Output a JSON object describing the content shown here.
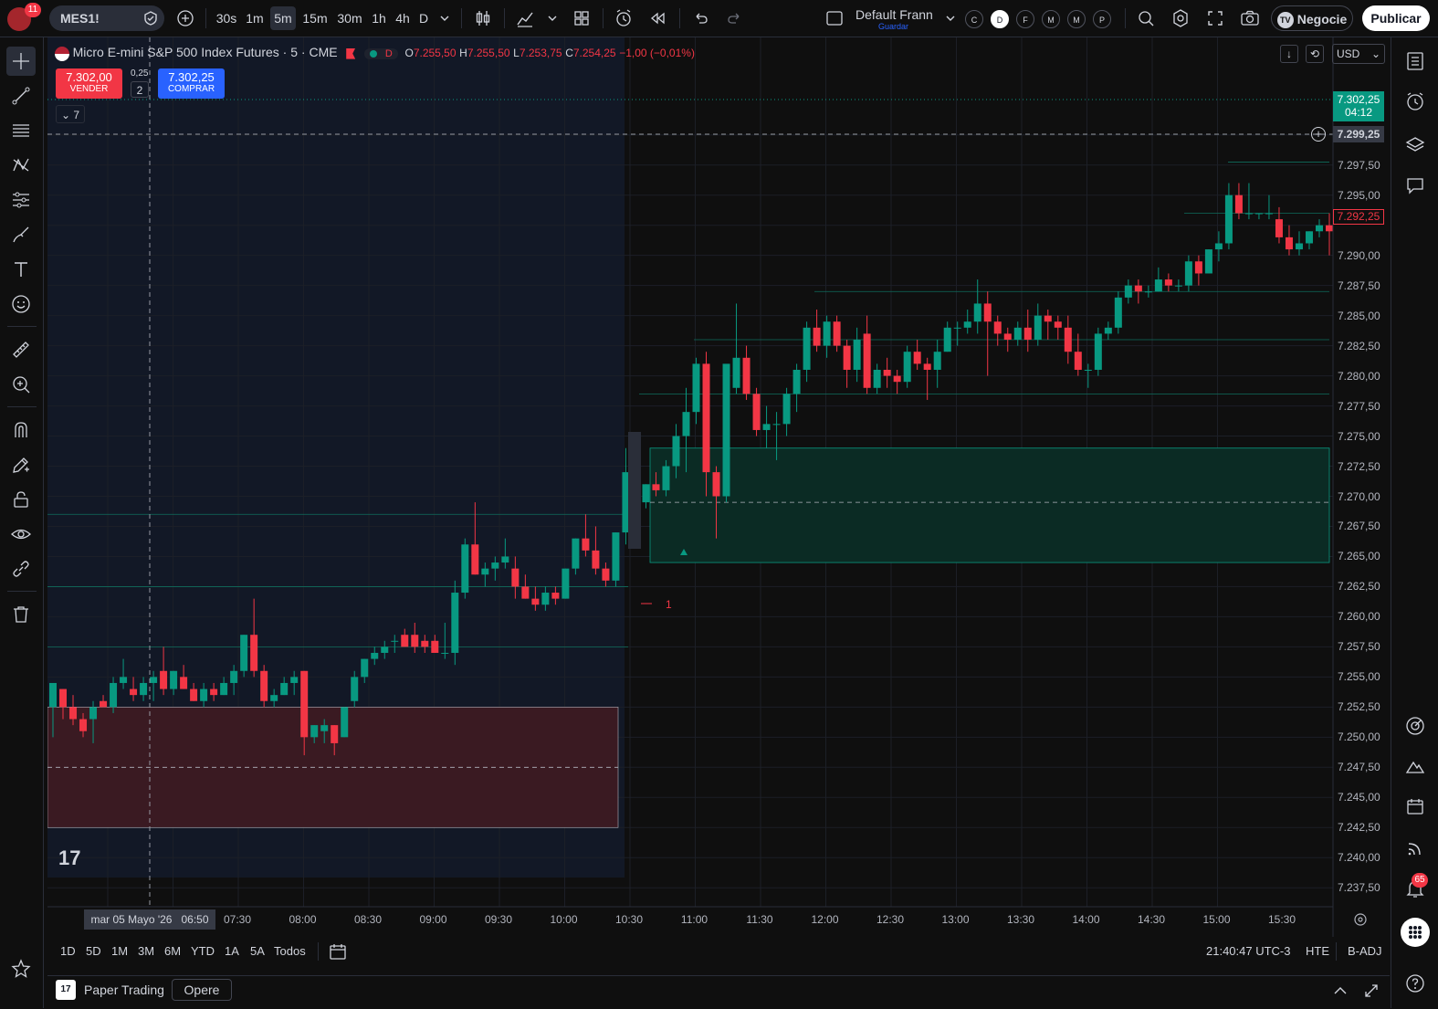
{
  "topbar": {
    "notif_count": "11",
    "symbol": "MES1!",
    "intervals": [
      "30s",
      "1m",
      "5m",
      "15m",
      "30m",
      "1h",
      "4h",
      "D"
    ],
    "active_interval": "5m",
    "layout_name": "Default Frann",
    "layout_sub": "Guardar",
    "quick_circles": [
      "C",
      "D",
      "F",
      "M",
      "M",
      "P"
    ],
    "trade_label": "Negocie",
    "publish_label": "Publicar"
  },
  "legend": {
    "title": "Micro E-mini S&P 500 Index Futures · 5 · CME",
    "d_badge": "D",
    "o_label": "O",
    "o_val": "7.255,50",
    "h_label": "H",
    "h_val": "7.255,50",
    "l_label": "L",
    "l_val": "7.253,75",
    "c_label": "C",
    "c_val": "7.254,25",
    "change": "−1,00 (−0,01%)",
    "currency": "USD",
    "sell_price": "7.302,00",
    "sell_label": "VENDER",
    "spread": "0,25",
    "qty": "2",
    "buy_price": "7.302,25",
    "buy_label": "COMPRAR",
    "indicator_count": "7"
  },
  "price_axis": {
    "labels": [
      "7.297,50",
      "7.295,00",
      "7.290,00",
      "7.287,50",
      "7.285,00",
      "7.282,50",
      "7.280,00",
      "7.277,50",
      "7.275,00",
      "7.272,50",
      "7.270,00",
      "7.267,50",
      "7.265,00",
      "7.262,50",
      "7.260,00",
      "7.257,50",
      "7.255,00",
      "7.252,50",
      "7.250,00",
      "7.247,50",
      "7.245,00",
      "7.242,50",
      "7.240,00",
      "7.237,50"
    ],
    "last_price": "7.302,25",
    "countdown": "04:12",
    "crosshair_price": "7.299,25",
    "marked_price": "7.292,25"
  },
  "time_axis": {
    "crosshair_date": "mar 05 Mayo '26",
    "crosshair_time": "06:50",
    "labels": [
      "07:30",
      "08:00",
      "08:30",
      "09:00",
      "09:30",
      "10:00",
      "10:30",
      "11:00",
      "11:30",
      "12:00",
      "12:30",
      "13:00",
      "13:30",
      "14:00",
      "14:30",
      "15:00",
      "15:30"
    ]
  },
  "chart": {
    "position_marker": "1",
    "up_color": "#089981",
    "down_color": "#f23645"
  },
  "chart_data": {
    "type": "candlestick",
    "title": "Micro E-mini S&P 500 Index Futures · 5 · CME",
    "ylim": [
      7236.0,
      7304.0
    ],
    "candles": [
      [
        7252.5,
        7254.5,
        7250.0,
        7254.5
      ],
      [
        7254.0,
        7254.0,
        7251.5,
        7252.5
      ],
      [
        7252.5,
        7253.5,
        7251.0,
        7251.5
      ],
      [
        7251.5,
        7252.0,
        7250.0,
        7250.5
      ],
      [
        7251.5,
        7253.0,
        7249.5,
        7252.5
      ],
      [
        7253.0,
        7253.5,
        7252.5,
        7252.5
      ],
      [
        7252.5,
        7255.0,
        7252.0,
        7254.5
      ],
      [
        7254.5,
        7256.5,
        7254.0,
        7255.0
      ],
      [
        7254.0,
        7255.0,
        7253.0,
        7253.5
      ],
      [
        7253.5,
        7255.0,
        7253.0,
        7254.5
      ],
      [
        7254.5,
        7255.5,
        7253.0,
        7255.0
      ],
      [
        7255.5,
        7257.5,
        7253.5,
        7254.0
      ],
      [
        7254.0,
        7255.5,
        7253.5,
        7255.5
      ],
      [
        7255.0,
        7256.0,
        7254.0,
        7254.0
      ],
      [
        7254.0,
        7254.5,
        7253.0,
        7253.0
      ],
      [
        7253.0,
        7254.5,
        7252.5,
        7254.0
      ],
      [
        7254.0,
        7254.5,
        7253.0,
        7253.5
      ],
      [
        7253.5,
        7255.0,
        7253.5,
        7254.5
      ],
      [
        7254.5,
        7256.0,
        7253.5,
        7255.5
      ],
      [
        7255.5,
        7258.5,
        7255.0,
        7258.5
      ],
      [
        7258.5,
        7261.5,
        7255.0,
        7255.5
      ],
      [
        7255.5,
        7256.0,
        7252.5,
        7253.0
      ],
      [
        7253.0,
        7254.0,
        7252.5,
        7253.5
      ],
      [
        7253.5,
        7255.0,
        7253.5,
        7254.5
      ],
      [
        7254.5,
        7255.5,
        7253.5,
        7255.0
      ],
      [
        7255.5,
        7255.5,
        7248.5,
        7250.0
      ],
      [
        7250.0,
        7251.0,
        7249.5,
        7251.0
      ],
      [
        7250.5,
        7251.5,
        7249.5,
        7251.0
      ],
      [
        7251.0,
        7251.0,
        7248.5,
        7249.5
      ],
      [
        7250.0,
        7252.5,
        7250.0,
        7252.5
      ],
      [
        7253.0,
        7255.5,
        7252.5,
        7255.0
      ],
      [
        7255.0,
        7256.5,
        7254.5,
        7256.5
      ],
      [
        7256.5,
        7257.5,
        7256.0,
        7257.0
      ],
      [
        7257.0,
        7258.0,
        7256.5,
        7257.5
      ],
      [
        7258.0,
        7258.5,
        7257.0,
        7258.0
      ],
      [
        7258.5,
        7259.0,
        7257.5,
        7257.5
      ],
      [
        7258.5,
        7259.5,
        7257.0,
        7257.5
      ],
      [
        7258.0,
        7258.5,
        7257.0,
        7257.5
      ],
      [
        7258.0,
        7258.5,
        7257.0,
        7257.0
      ],
      [
        7257.0,
        7259.5,
        7256.5,
        7257.0
      ],
      [
        7257.0,
        7263.0,
        7256.0,
        7262.0
      ],
      [
        7262.0,
        7266.5,
        7261.5,
        7266.0
      ],
      [
        7266.0,
        7269.5,
        7263.5,
        7263.5
      ],
      [
        7263.5,
        7264.5,
        7262.5,
        7264.0
      ],
      [
        7264.0,
        7265.0,
        7263.0,
        7264.5
      ],
      [
        7264.5,
        7266.5,
        7264.0,
        7265.0
      ],
      [
        7264.0,
        7265.0,
        7261.5,
        7262.5
      ],
      [
        7262.5,
        7263.5,
        7261.5,
        7261.5
      ],
      [
        7261.5,
        7262.5,
        7260.5,
        7261.0
      ],
      [
        7261.0,
        7262.5,
        7260.5,
        7262.0
      ],
      [
        7262.0,
        7262.5,
        7261.0,
        7261.5
      ],
      [
        7261.5,
        7264.0,
        7261.5,
        7264.0
      ],
      [
        7264.0,
        7266.5,
        7263.5,
        7266.5
      ],
      [
        7266.5,
        7268.5,
        7265.0,
        7265.5
      ],
      [
        7265.5,
        7267.5,
        7263.5,
        7264.0
      ],
      [
        7264.0,
        7264.5,
        7262.5,
        7263.0
      ],
      [
        7263.0,
        7267.0,
        7262.5,
        7267.0
      ],
      [
        7267.0,
        7274.0,
        7266.0,
        7272.0
      ],
      [
        7272.0,
        7273.0,
        7269.0,
        7269.5
      ],
      [
        7269.5,
        7271.0,
        7269.0,
        7271.0
      ],
      [
        7271.0,
        7272.0,
        7270.0,
        7270.5
      ],
      [
        7270.5,
        7273.0,
        7270.0,
        7272.5
      ],
      [
        7272.5,
        7276.0,
        7271.5,
        7275.0
      ],
      [
        7275.0,
        7279.0,
        7272.0,
        7277.0
      ],
      [
        7277.0,
        7281.5,
        7276.0,
        7281.0
      ],
      [
        7281.0,
        7282.0,
        7270.0,
        7272.0
      ],
      [
        7272.0,
        7272.5,
        7266.5,
        7270.0
      ],
      [
        7270.0,
        7279.5,
        7269.5,
        7281.0
      ],
      [
        7279.0,
        7286.0,
        7278.5,
        7281.5
      ],
      [
        7281.5,
        7282.5,
        7278.0,
        7278.5
      ],
      [
        7278.5,
        7279.0,
        7275.0,
        7275.5
      ],
      [
        7275.5,
        7277.5,
        7274.0,
        7276.0
      ],
      [
        7276.0,
        7277.0,
        7273.0,
        7276.0
      ],
      [
        7276.0,
        7279.0,
        7275.0,
        7278.5
      ],
      [
        7278.5,
        7281.0,
        7277.0,
        7280.5
      ],
      [
        7280.5,
        7284.5,
        7279.5,
        7284.0
      ],
      [
        7284.0,
        7285.5,
        7282.0,
        7282.5
      ],
      [
        7282.5,
        7285.0,
        7281.5,
        7284.5
      ],
      [
        7284.5,
        7285.0,
        7282.0,
        7282.5
      ],
      [
        7282.5,
        7283.0,
        7279.0,
        7280.5
      ],
      [
        7280.5,
        7284.0,
        7279.5,
        7283.0
      ],
      [
        7283.5,
        7285.0,
        7278.5,
        7279.0
      ],
      [
        7279.0,
        7281.0,
        7278.5,
        7280.5
      ],
      [
        7280.5,
        7281.5,
        7279.0,
        7280.0
      ],
      [
        7280.0,
        7280.5,
        7278.5,
        7279.5
      ],
      [
        7279.5,
        7282.5,
        7279.0,
        7282.0
      ],
      [
        7282.0,
        7283.0,
        7280.5,
        7281.0
      ],
      [
        7281.0,
        7281.5,
        7278.0,
        7280.5
      ],
      [
        7280.5,
        7283.0,
        7279.0,
        7282.0
      ],
      [
        7282.0,
        7284.5,
        7282.0,
        7284.0
      ],
      [
        7284.0,
        7284.5,
        7282.5,
        7284.0
      ],
      [
        7284.0,
        7285.5,
        7283.5,
        7284.5
      ],
      [
        7284.5,
        7288.0,
        7283.5,
        7286.0
      ],
      [
        7286.0,
        7287.0,
        7280.0,
        7284.5
      ],
      [
        7284.5,
        7285.0,
        7282.5,
        7283.5
      ],
      [
        7283.5,
        7284.0,
        7282.0,
        7283.0
      ],
      [
        7283.0,
        7284.5,
        7282.5,
        7284.0
      ],
      [
        7284.0,
        7285.5,
        7282.0,
        7283.0
      ],
      [
        7283.0,
        7286.0,
        7282.5,
        7285.0
      ],
      [
        7285.0,
        7285.5,
        7283.0,
        7284.5
      ],
      [
        7284.5,
        7285.0,
        7283.0,
        7284.0
      ],
      [
        7284.0,
        7285.0,
        7281.0,
        7282.0
      ],
      [
        7282.0,
        7283.5,
        7280.0,
        7280.5
      ],
      [
        7280.5,
        7281.0,
        7279.0,
        7280.5
      ],
      [
        7280.5,
        7284.0,
        7280.0,
        7283.5
      ],
      [
        7283.5,
        7284.5,
        7283.0,
        7284.0
      ],
      [
        7284.0,
        7287.0,
        7283.5,
        7286.5
      ],
      [
        7286.5,
        7288.0,
        7286.0,
        7287.5
      ],
      [
        7287.5,
        7288.0,
        7286.0,
        7287.0
      ],
      [
        7287.0,
        7287.5,
        7286.5,
        7287.0
      ],
      [
        7287.0,
        7289.0,
        7287.0,
        7288.0
      ],
      [
        7288.0,
        7288.5,
        7287.0,
        7287.5
      ],
      [
        7287.5,
        7288.0,
        7287.0,
        7287.5
      ],
      [
        7287.5,
        7290.0,
        7287.0,
        7289.5
      ],
      [
        7289.5,
        7290.0,
        7287.5,
        7288.5
      ],
      [
        7288.5,
        7290.5,
        7288.5,
        7290.5
      ],
      [
        7290.5,
        7292.0,
        7289.5,
        7291.0
      ],
      [
        7291.0,
        7296.0,
        7290.5,
        7295.0
      ],
      [
        7295.0,
        7296.0,
        7293.0,
        7293.5
      ],
      [
        7293.5,
        7296.0,
        7293.0,
        7293.5
      ],
      [
        7293.5,
        7293.5,
        7293.0,
        7293.5
      ],
      [
        7293.5,
        7295.0,
        7293.0,
        7293.5
      ],
      [
        7293.0,
        7294.0,
        7291.0,
        7291.5
      ],
      [
        7291.5,
        7292.5,
        7290.0,
        7290.5
      ],
      [
        7290.5,
        7292.0,
        7290.0,
        7291.0
      ],
      [
        7291.0,
        7292.0,
        7290.5,
        7292.0
      ],
      [
        7292.0,
        7293.0,
        7291.5,
        7292.5
      ],
      [
        7292.5,
        7293.5,
        7290.0,
        7292.0
      ]
    ],
    "zones": [
      {
        "name": "demand-zone",
        "top": 7274.0,
        "bottom": 7264.5,
        "mid": 7269.5,
        "color": "#0b2b24"
      },
      {
        "name": "supply-zone",
        "top": 7252.5,
        "bottom": 7242.5,
        "mid": 7247.5,
        "color": "#3a1a22"
      }
    ],
    "horizontal_levels": [
      7287.0,
      7283.0,
      7278.5,
      7293.5,
      7268.5,
      7262.5,
      7257.5
    ],
    "session_split": "10:30",
    "legend": "none",
    "grid": true
  },
  "bottombar": {
    "ranges": [
      "1D",
      "5D",
      "1M",
      "3M",
      "6M",
      "YTD",
      "1A",
      "5A",
      "Todos"
    ],
    "clock": "21:40:47 UTC-3",
    "hte": "HTE",
    "badj": "B-ADJ"
  },
  "statusbar": {
    "broker": "Paper Trading",
    "trade_btn": "Opere"
  },
  "right_notif": "65"
}
